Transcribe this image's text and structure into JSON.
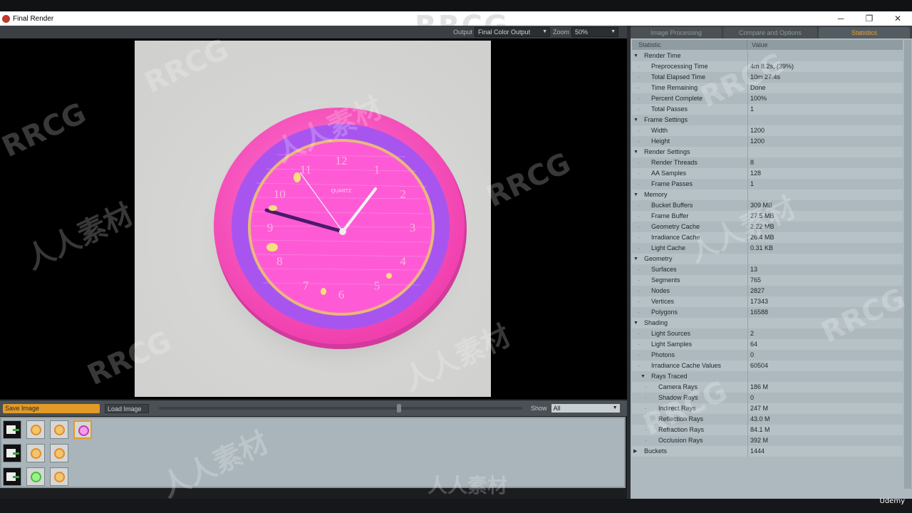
{
  "window": {
    "title": "Final Render",
    "minimize": "─",
    "maximize": "❐",
    "close": "✕"
  },
  "toolbar": {
    "output_label": "Output",
    "output_value": "Final Color Output",
    "zoom_label": "Zoom",
    "zoom_value": "50%"
  },
  "render": {
    "clock": {
      "numerals": [
        "12",
        "1",
        "2",
        "3",
        "4",
        "5",
        "6",
        "7",
        "8",
        "9",
        "10",
        "11"
      ],
      "brand": "QUARTZ"
    }
  },
  "bottom": {
    "save_label": "Save Image",
    "load_label": "Load Image",
    "show_label": "Show",
    "show_value": "All",
    "slider_fraction": 0.66
  },
  "thumbnails": [
    {
      "kind": "doc"
    },
    {
      "kind": "orange"
    },
    {
      "kind": "orange"
    },
    {
      "kind": "pink",
      "active": true
    },
    {
      "kind": "doc"
    },
    {
      "kind": "orange"
    },
    {
      "kind": "orange"
    },
    {
      "kind": "doc"
    },
    {
      "kind": "green"
    },
    {
      "kind": "orange"
    }
  ],
  "tabs": [
    {
      "label": "Image Processing",
      "active": false
    },
    {
      "label": "Compare and Options",
      "active": false
    },
    {
      "label": "Statistics",
      "active": true
    }
  ],
  "table": {
    "headers": [
      "Statistic",
      "Value"
    ],
    "rows": [
      {
        "level": 0,
        "expand": "down",
        "label": "Render Time",
        "value": ""
      },
      {
        "level": 1,
        "label": "Preprocessing Time",
        "value": "4m 8.2s, (39%)"
      },
      {
        "level": 1,
        "label": "Total Elapsed Time",
        "value": "10m 27.4s"
      },
      {
        "level": 1,
        "label": "Time Remaining",
        "value": "Done"
      },
      {
        "level": 1,
        "label": "Percent Complete",
        "value": "100%"
      },
      {
        "level": 1,
        "label": "Total Passes",
        "value": "1"
      },
      {
        "level": 0,
        "expand": "down",
        "label": "Frame Settings",
        "value": ""
      },
      {
        "level": 1,
        "label": "Width",
        "value": "1200"
      },
      {
        "level": 1,
        "label": "Height",
        "value": "1200"
      },
      {
        "level": 0,
        "expand": "down",
        "label": "Render Settings",
        "value": ""
      },
      {
        "level": 1,
        "label": "Render Threads",
        "value": "8"
      },
      {
        "level": 1,
        "label": "AA Samples",
        "value": "128"
      },
      {
        "level": 1,
        "label": "Frame Passes",
        "value": "1"
      },
      {
        "level": 0,
        "expand": "down",
        "label": "Memory",
        "value": ""
      },
      {
        "level": 1,
        "label": "Bucket Buffers",
        "value": "309 MB"
      },
      {
        "level": 1,
        "label": "Frame Buffer",
        "value": "27.5 MB"
      },
      {
        "level": 1,
        "label": "Geometry Cache",
        "value": "2.22 MB"
      },
      {
        "level": 1,
        "label": "Irradiance Cache",
        "value": "26.4 MB"
      },
      {
        "level": 1,
        "label": "Light Cache",
        "value": "0.31 KB"
      },
      {
        "level": 0,
        "expand": "down",
        "label": "Geometry",
        "value": ""
      },
      {
        "level": 1,
        "label": "Surfaces",
        "value": "13"
      },
      {
        "level": 1,
        "label": "Segments",
        "value": "765"
      },
      {
        "level": 1,
        "label": "Nodes",
        "value": "2827"
      },
      {
        "level": 1,
        "label": "Vertices",
        "value": "17343"
      },
      {
        "level": 1,
        "label": "Polygons",
        "value": "16588"
      },
      {
        "level": 0,
        "expand": "down",
        "label": "Shading",
        "value": ""
      },
      {
        "level": 1,
        "label": "Light Sources",
        "value": "2"
      },
      {
        "level": 1,
        "label": "Light Samples",
        "value": "64"
      },
      {
        "level": 1,
        "label": "Photons",
        "value": "0"
      },
      {
        "level": 1,
        "label": "Irradiance Cache Values",
        "value": "60504"
      },
      {
        "level": 1,
        "expand": "down",
        "label": "Rays Traced",
        "value": ""
      },
      {
        "level": 2,
        "label": "Camera Rays",
        "value": "186 M"
      },
      {
        "level": 2,
        "label": "Shadow Rays",
        "value": "0"
      },
      {
        "level": 2,
        "label": "Indirect Rays",
        "value": "247 M"
      },
      {
        "level": 2,
        "label": "Reflection Rays",
        "value": "43.0 M"
      },
      {
        "level": 2,
        "label": "Refraction Rays",
        "value": "84.1 M"
      },
      {
        "level": 2,
        "label": "Occlusion Rays",
        "value": "392 M"
      },
      {
        "level": 0,
        "expand": "right",
        "label": "Buckets",
        "value": "1444"
      }
    ]
  },
  "watermarks": {
    "top": "RRCG",
    "bottom": "人人素材",
    "footer_logo": "Udemy"
  },
  "colors": {
    "accent": "#e39a27",
    "clock_ring": "#ff4fc0",
    "clock_inner": "#a855f0",
    "clock_face": "#ff5ad6"
  }
}
